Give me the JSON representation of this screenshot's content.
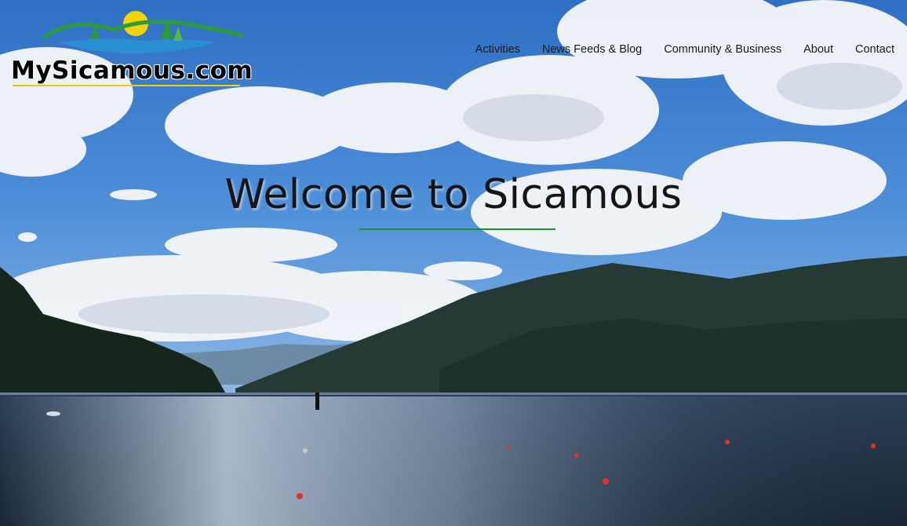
{
  "site": {
    "logo_text": "MySicamous.com"
  },
  "nav": {
    "items": [
      {
        "label": "Activities"
      },
      {
        "label": "News Feeds & Blog"
      },
      {
        "label": "Community & Business"
      },
      {
        "label": "About"
      },
      {
        "label": "Contact"
      }
    ]
  },
  "hero": {
    "headline": "Welcome to Sicamous"
  },
  "colors": {
    "accent_rule": "#1c8f2c",
    "logo_yellow": "#f3d400",
    "logo_green": "#2d9a3a",
    "logo_blue": "#2a8fd0"
  }
}
